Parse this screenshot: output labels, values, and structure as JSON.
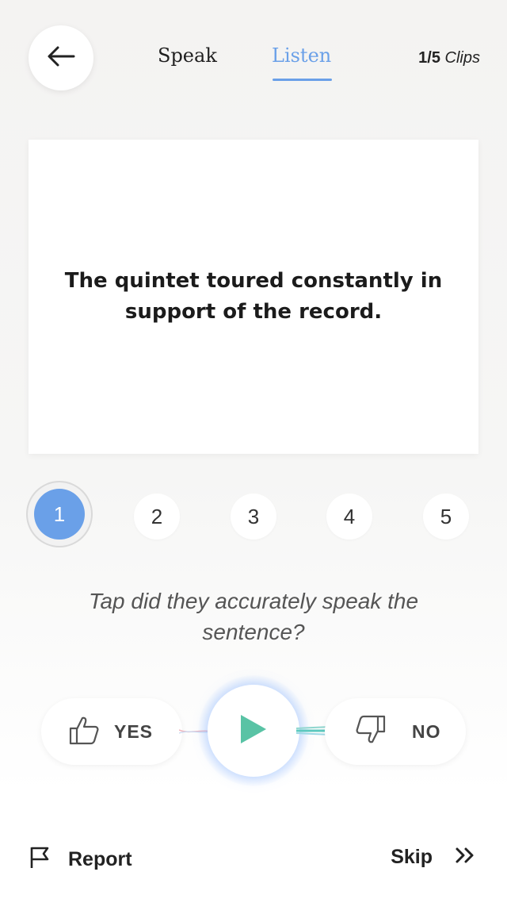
{
  "header": {
    "tabs": [
      {
        "label": "Speak",
        "active": false
      },
      {
        "label": "Listen",
        "active": true
      }
    ],
    "clips_count": "1/5",
    "clips_word": "Clips"
  },
  "card": {
    "sentence": "The quintet toured constantly in support of the record."
  },
  "clips": {
    "items": [
      "1",
      "2",
      "3",
      "4",
      "5"
    ],
    "active": "1"
  },
  "prompt": "Tap did they accurately speak the sentence?",
  "vote": {
    "yes_label": "YES",
    "no_label": "NO"
  },
  "footer": {
    "report_label": "Report",
    "skip_label": "Skip"
  },
  "colors": {
    "accent": "#6aa0e8",
    "play": "#59c3a5"
  }
}
